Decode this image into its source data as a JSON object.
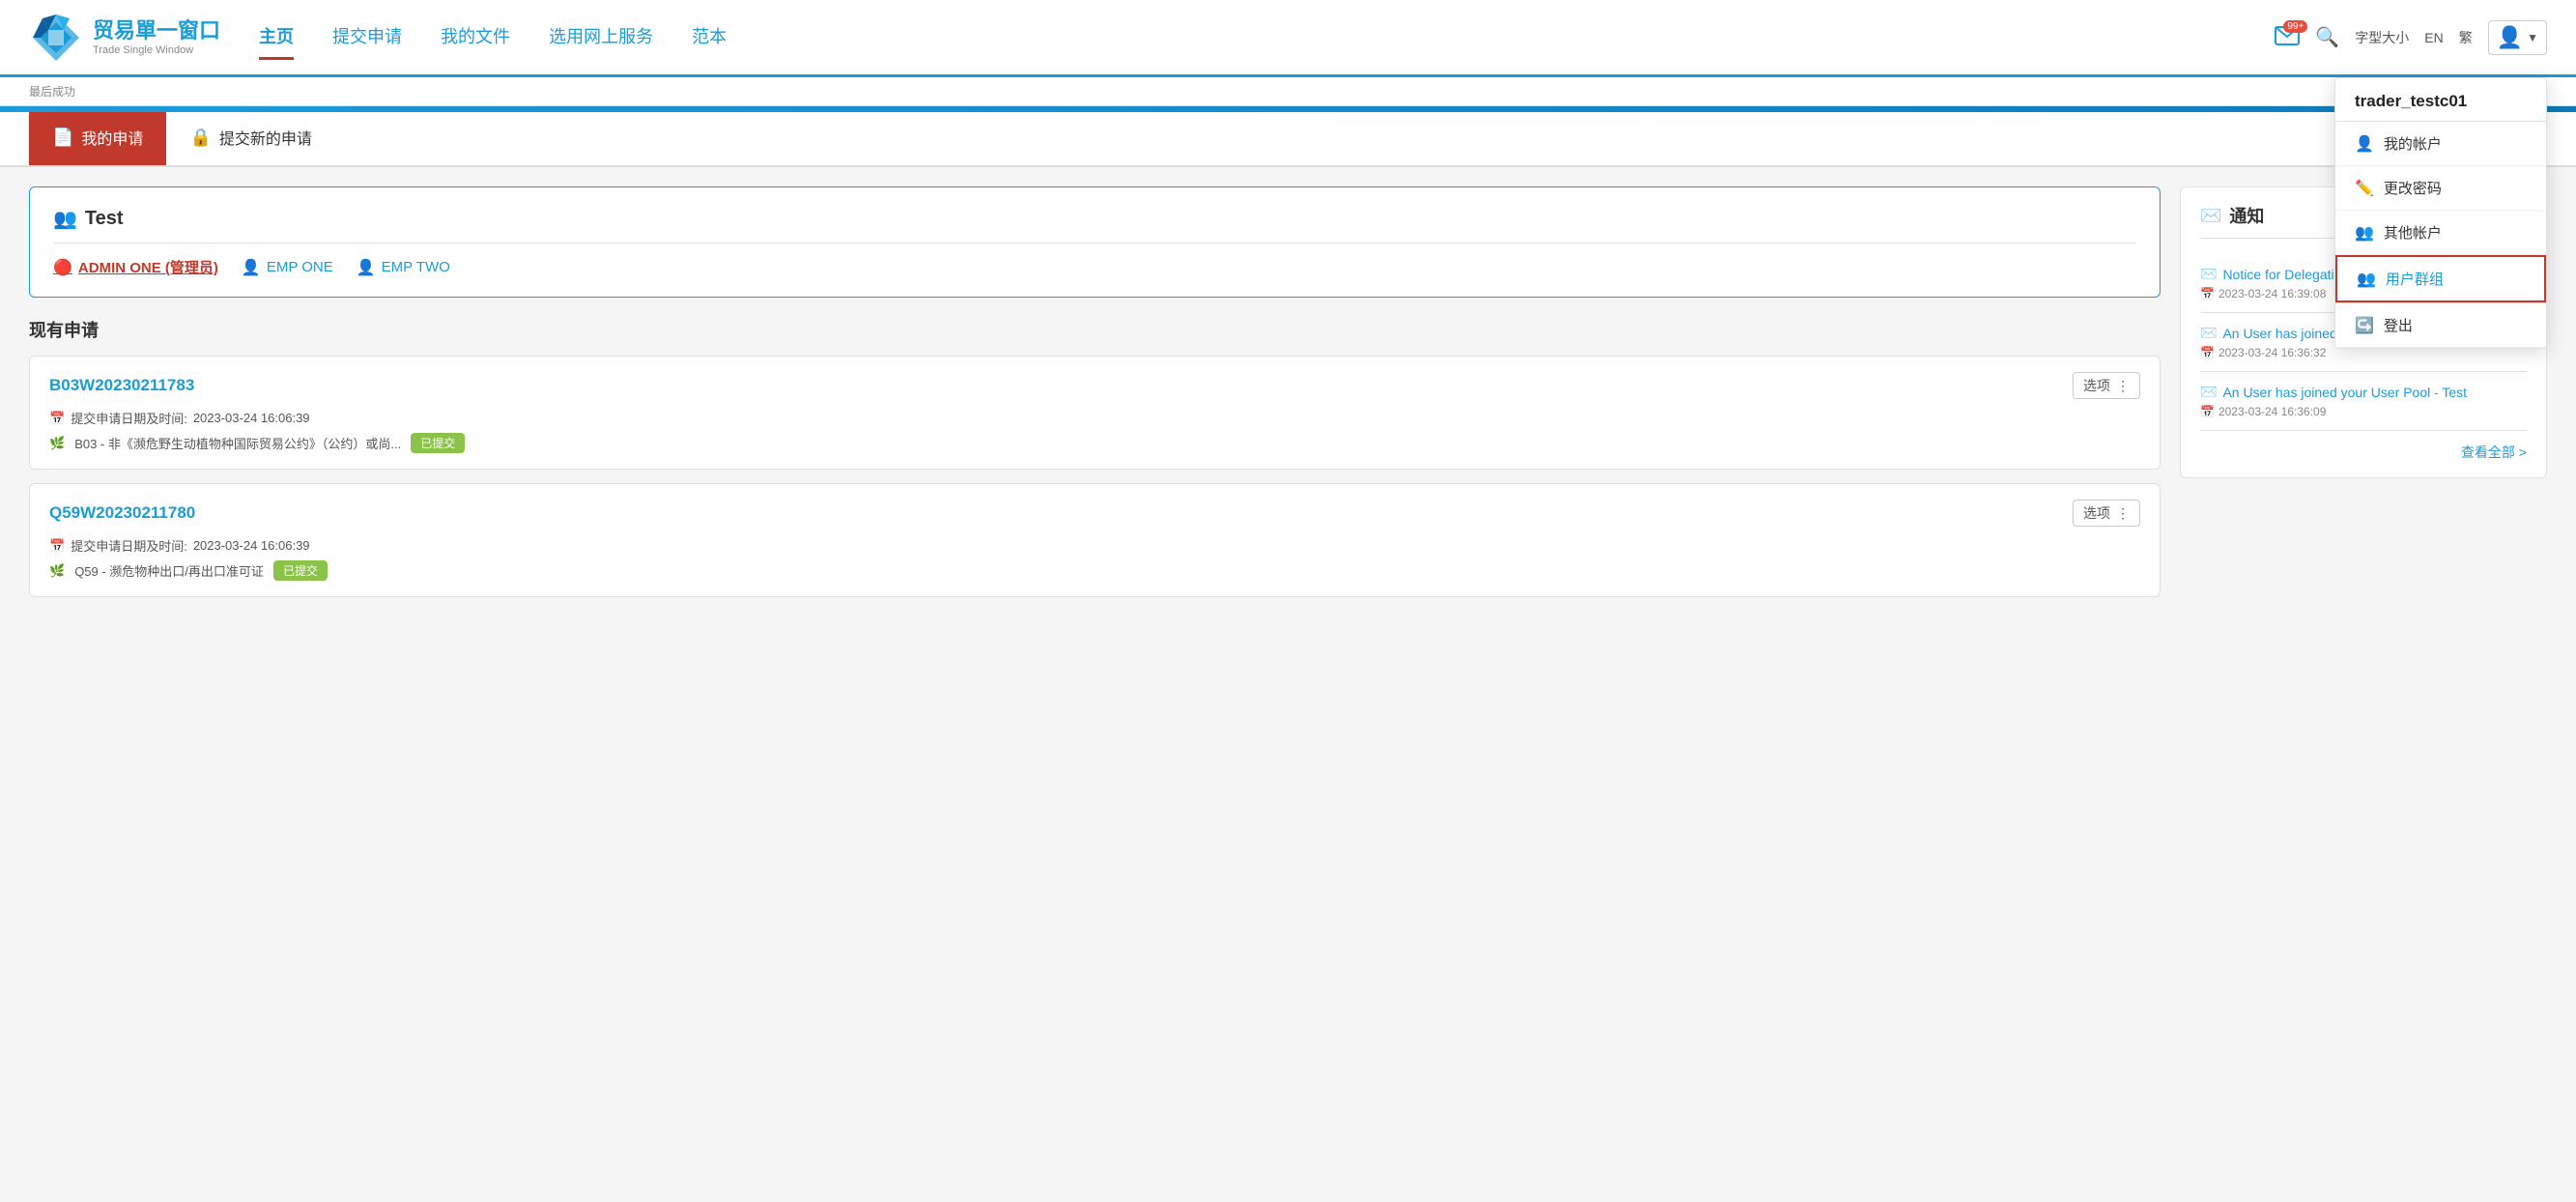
{
  "header": {
    "logo_cn": "贸易單一窗口",
    "logo_en": "Trade Single Window",
    "nav_items": [
      {
        "label": "主页",
        "active": true
      },
      {
        "label": "提交申请",
        "active": false
      },
      {
        "label": "我的文件",
        "active": false
      },
      {
        "label": "选用网上服务",
        "active": false
      },
      {
        "label": "范本",
        "active": false
      }
    ],
    "notification_badge": "99+",
    "font_size_label": "字型大小",
    "lang_en": "EN",
    "lang_tc": "繁",
    "username": "trader_testc01",
    "last_login_label": "最后成功"
  },
  "dropdown": {
    "username": "trader_testc01",
    "items": [
      {
        "label": "我的帐户",
        "icon": "person"
      },
      {
        "label": "更改密码",
        "icon": "pencil"
      },
      {
        "label": "其他帐户",
        "icon": "people"
      },
      {
        "label": "用户群组",
        "icon": "people",
        "highlighted": true
      },
      {
        "label": "登出",
        "icon": "arrow-right"
      }
    ]
  },
  "tabs": [
    {
      "label": "我的申请",
      "icon": "doc",
      "active": true
    },
    {
      "label": "提交新的申请",
      "icon": "lock",
      "active": false
    }
  ],
  "user_group_card": {
    "title": "Test",
    "title_icon": "people",
    "members": [
      {
        "name": "ADMIN ONE (管理员)",
        "role": "admin"
      },
      {
        "name": "EMP ONE",
        "role": "emp"
      },
      {
        "name": "EMP TWO",
        "role": "emp"
      }
    ]
  },
  "section_current": "现有申请",
  "applications": [
    {
      "id": "B03W20230211783",
      "options_label": "选项",
      "date_label": "提交申请日期及时间:",
      "date_value": "2023-03-24 16:06:39",
      "desc": "B03 - 非《濒危野生动植物种国际贸易公约》（公约）或尚...",
      "status": "已提交"
    },
    {
      "id": "Q59W20230211780",
      "options_label": "选项",
      "date_label": "提交申请日期及时间:",
      "date_value": "2023-03-24 16:06:39",
      "desc": "Q59 - 濒危物种出口/再出口准可证",
      "status": "已提交"
    }
  ],
  "notifications": {
    "title": "通知",
    "items": [
      {
        "title": "Notice for Delegation",
        "date": "2023-03-24 16:39:08"
      },
      {
        "title": "An User has joined your User Pool - Test",
        "date": "2023-03-24 16:36:32"
      },
      {
        "title": "An User has joined your User Pool - Test",
        "date": "2023-03-24 16:36:09"
      }
    ],
    "see_all_label": "查看全部 >"
  }
}
